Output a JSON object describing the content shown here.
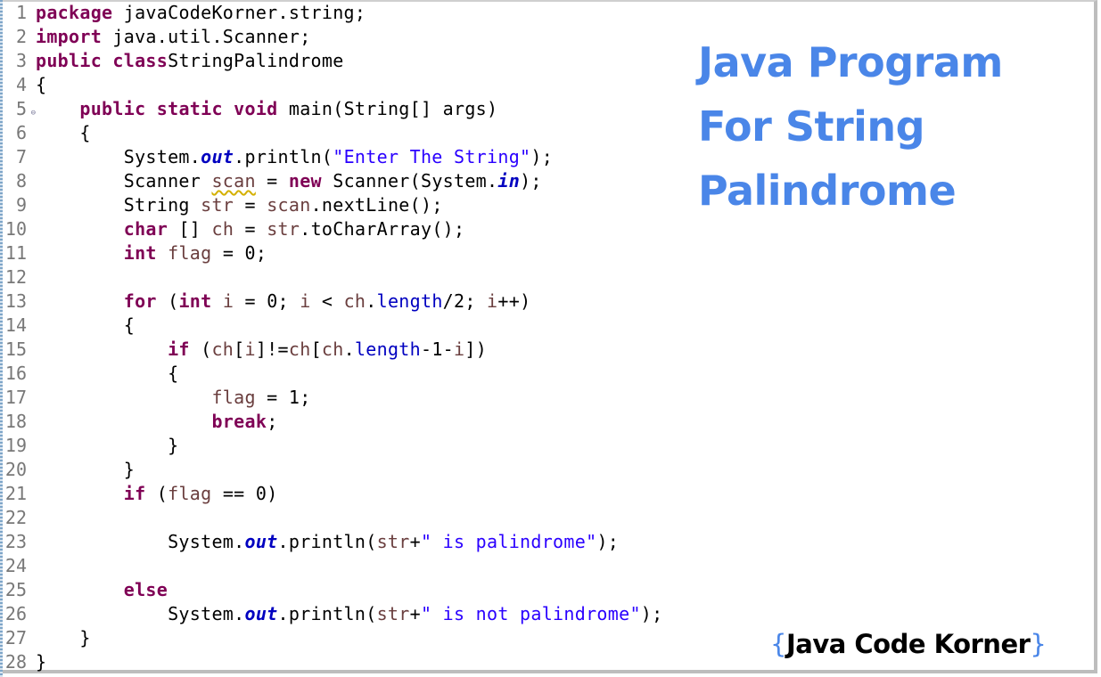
{
  "title": {
    "lines": [
      "Java Program",
      "For String",
      "Palindrome"
    ],
    "color": "#4a86e8"
  },
  "brand": {
    "open_brace": "{",
    "name": "Java Code Korner",
    "close_brace": "}"
  },
  "code": {
    "language": "java",
    "colors": {
      "keyword": "#7f0055",
      "local_variable": "#6a3e3e",
      "string": "#2a00ff",
      "field": "#0000c0",
      "line_number": "#787878"
    },
    "lines": [
      {
        "n": "1",
        "tokens": [
          [
            "kw",
            "package"
          ],
          [
            "",
            "javaCodeKorner.string;"
          ]
        ]
      },
      {
        "n": "2",
        "tokens": [
          [
            "kw",
            "import"
          ],
          [
            "",
            "java.util.Scanner;"
          ]
        ]
      },
      {
        "n": "3",
        "tokens": [
          [
            "kw",
            "public"
          ],
          [
            "",
            " "
          ],
          [
            "kw",
            "class"
          ],
          [
            "",
            ""
          ],
          [
            "",
            "StringPalindrome"
          ]
        ]
      },
      {
        "n": "4",
        "tokens": [
          [
            "",
            "{"
          ]
        ]
      },
      {
        "n": "5",
        "fold": true,
        "tokens": [
          [
            "",
            "    "
          ],
          [
            "kw",
            "public"
          ],
          [
            "",
            " "
          ],
          [
            "kw",
            "static"
          ],
          [
            "",
            " "
          ],
          [
            "kw",
            "void"
          ],
          [
            "",
            " main(String[] args)"
          ]
        ]
      },
      {
        "n": "6",
        "tokens": [
          [
            "",
            "    {"
          ]
        ]
      },
      {
        "n": "7",
        "tokens": [
          [
            "",
            "        System."
          ],
          [
            "sfld",
            "out"
          ],
          [
            "",
            ".println("
          ],
          [
            "str",
            "\"Enter The String\""
          ],
          [
            "",
            ");"
          ]
        ]
      },
      {
        "n": "8",
        "tokens": [
          [
            "",
            "        Scanner "
          ],
          [
            "var warn",
            "scan"
          ],
          [
            "",
            " = "
          ],
          [
            "kw",
            "new"
          ],
          [
            "",
            " Scanner(System."
          ],
          [
            "sfld",
            "in"
          ],
          [
            "",
            ");"
          ]
        ]
      },
      {
        "n": "9",
        "tokens": [
          [
            "",
            "        String "
          ],
          [
            "var",
            "str"
          ],
          [
            "",
            " = "
          ],
          [
            "var",
            "scan"
          ],
          [
            "",
            ".nextLine();"
          ]
        ]
      },
      {
        "n": "10",
        "tokens": [
          [
            "",
            "        "
          ],
          [
            "kw",
            "char"
          ],
          [
            "",
            " [] "
          ],
          [
            "var",
            "ch"
          ],
          [
            "",
            " = "
          ],
          [
            "var",
            "str"
          ],
          [
            "",
            ".toCharArray();"
          ]
        ]
      },
      {
        "n": "11",
        "tokens": [
          [
            "",
            "        "
          ],
          [
            "kw",
            "int"
          ],
          [
            "",
            " "
          ],
          [
            "var",
            "flag"
          ],
          [
            "",
            " = 0;"
          ]
        ]
      },
      {
        "n": "12",
        "tokens": [
          [
            "",
            ""
          ]
        ]
      },
      {
        "n": "13",
        "tokens": [
          [
            "",
            "        "
          ],
          [
            "kw",
            "for"
          ],
          [
            "",
            " ("
          ],
          [
            "kw",
            "int"
          ],
          [
            "",
            " "
          ],
          [
            "var",
            "i"
          ],
          [
            "",
            " = 0; "
          ],
          [
            "var",
            "i"
          ],
          [
            "",
            " < "
          ],
          [
            "var",
            "ch"
          ],
          [
            "",
            "."
          ],
          [
            "fld",
            "length"
          ],
          [
            "",
            "/2; "
          ],
          [
            "var",
            "i"
          ],
          [
            "",
            "++)"
          ]
        ]
      },
      {
        "n": "14",
        "tokens": [
          [
            "",
            "        {"
          ]
        ]
      },
      {
        "n": "15",
        "tokens": [
          [
            "",
            "            "
          ],
          [
            "kw",
            "if"
          ],
          [
            "",
            " ("
          ],
          [
            "var",
            "ch"
          ],
          [
            "",
            "["
          ],
          [
            "var",
            "i"
          ],
          [
            "",
            "]!="
          ],
          [
            "var",
            "ch"
          ],
          [
            "",
            "["
          ],
          [
            "var",
            "ch"
          ],
          [
            "",
            "."
          ],
          [
            "fld",
            "length"
          ],
          [
            "",
            "-1-"
          ],
          [
            "var",
            "i"
          ],
          [
            "",
            "])"
          ]
        ]
      },
      {
        "n": "16",
        "tokens": [
          [
            "",
            "            {"
          ]
        ]
      },
      {
        "n": "17",
        "tokens": [
          [
            "",
            "                "
          ],
          [
            "var",
            "flag"
          ],
          [
            "",
            " = 1;"
          ]
        ]
      },
      {
        "n": "18",
        "tokens": [
          [
            "",
            "                "
          ],
          [
            "kw",
            "break"
          ],
          [
            "",
            ";"
          ]
        ]
      },
      {
        "n": "19",
        "tokens": [
          [
            "",
            "            }"
          ]
        ]
      },
      {
        "n": "20",
        "tokens": [
          [
            "",
            "        }"
          ]
        ]
      },
      {
        "n": "21",
        "tokens": [
          [
            "",
            "        "
          ],
          [
            "kw",
            "if"
          ],
          [
            "",
            " ("
          ],
          [
            "var",
            "flag"
          ],
          [
            "",
            " == 0)"
          ]
        ]
      },
      {
        "n": "22",
        "tokens": [
          [
            "",
            ""
          ]
        ]
      },
      {
        "n": "23",
        "tokens": [
          [
            "",
            "            System."
          ],
          [
            "sfld",
            "out"
          ],
          [
            "",
            ".println("
          ],
          [
            "var",
            "str"
          ],
          [
            "",
            "+"
          ],
          [
            "str",
            "\" is palindrome\""
          ],
          [
            "",
            ");"
          ]
        ]
      },
      {
        "n": "24",
        "tokens": [
          [
            "",
            ""
          ]
        ]
      },
      {
        "n": "25",
        "tokens": [
          [
            "",
            "        "
          ],
          [
            "kw",
            "else"
          ]
        ]
      },
      {
        "n": "26",
        "tokens": [
          [
            "",
            "            System."
          ],
          [
            "sfld",
            "out"
          ],
          [
            "",
            ".println("
          ],
          [
            "var",
            "str"
          ],
          [
            "",
            "+"
          ],
          [
            "str",
            "\" is not palindrome\""
          ],
          [
            "",
            ");"
          ]
        ]
      },
      {
        "n": "27",
        "tokens": [
          [
            "",
            "    }"
          ]
        ]
      },
      {
        "n": "28",
        "tokens": [
          [
            "",
            "}"
          ]
        ]
      }
    ]
  }
}
